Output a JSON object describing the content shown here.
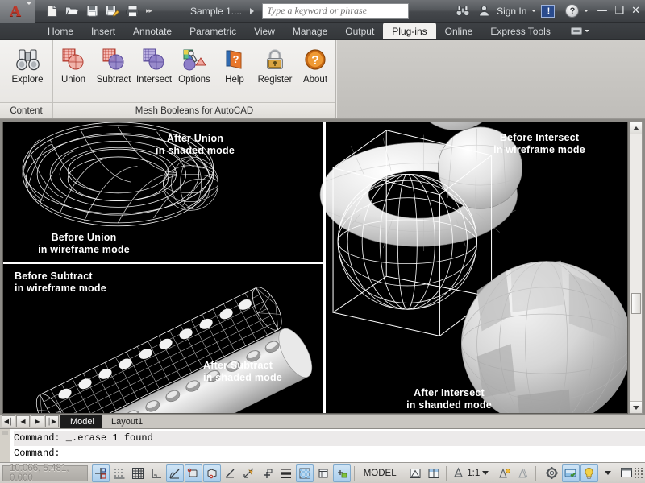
{
  "titlebar": {
    "app_logo": "autocad-a-logo",
    "quick_access": [
      {
        "name": "new-icon",
        "label": "New"
      },
      {
        "name": "open-icon",
        "label": "Open"
      },
      {
        "name": "save-icon",
        "label": "Save"
      },
      {
        "name": "save-as-icon",
        "label": "Save As"
      },
      {
        "name": "plot-icon",
        "label": "Plot"
      }
    ],
    "qat_more": "▸▸",
    "document_title": "Sample 1....",
    "search": {
      "placeholder": "Type a keyword or phrase",
      "value": ""
    },
    "search_icon": "binoculars-icon",
    "user_icon": "person-icon",
    "sign_in": "Sign In",
    "communication_center": "!",
    "help": "?",
    "window_controls": {
      "minimize": "—",
      "maximize": "❑",
      "close": "✕"
    }
  },
  "ribbon_tabs": {
    "items": [
      {
        "label": "Home",
        "active": false
      },
      {
        "label": "Insert",
        "active": false
      },
      {
        "label": "Annotate",
        "active": false
      },
      {
        "label": "Parametric",
        "active": false
      },
      {
        "label": "View",
        "active": false
      },
      {
        "label": "Manage",
        "active": false
      },
      {
        "label": "Output",
        "active": false
      },
      {
        "label": "Plug-ins",
        "active": true
      },
      {
        "label": "Online",
        "active": false
      },
      {
        "label": "Express Tools",
        "active": false
      }
    ]
  },
  "ribbon": {
    "panels": [
      {
        "label": "Content",
        "items": [
          {
            "label": "Explore",
            "icon": "binoculars-icon"
          }
        ]
      },
      {
        "label": "Mesh Booleans for AutoCAD",
        "items": [
          {
            "label": "Union",
            "icon": "boolean-union-icon"
          },
          {
            "label": "Subtract",
            "icon": "boolean-subtract-icon"
          },
          {
            "label": "Intersect",
            "icon": "boolean-intersect-icon"
          },
          {
            "label": "Options",
            "icon": "options-tools-icon"
          },
          {
            "label": "Help",
            "icon": "help-book-icon"
          },
          {
            "label": "Register",
            "icon": "padlock-icon"
          },
          {
            "label": "About",
            "icon": "about-question-icon"
          }
        ]
      }
    ]
  },
  "drawing": {
    "background_color": "#000000",
    "annotations": [
      {
        "name": "before-union-label",
        "line1": "Before Union",
        "line2": "in wireframe mode"
      },
      {
        "name": "after-union-label",
        "line1": "After Union",
        "line2": "in shaded mode"
      },
      {
        "name": "before-subtract-label",
        "line1": "Before Subtract",
        "line2": "in wireframe mode"
      },
      {
        "name": "after-subtract-label",
        "line1": "After Subtract",
        "line2": "in shaded mode"
      },
      {
        "name": "before-intersect-label",
        "line1": "Before Intersect",
        "line2": "in wireframe mode"
      },
      {
        "name": "after-intersect-label",
        "line1": "After Intersect",
        "line2": "in shanded mode"
      }
    ]
  },
  "layout_bar": {
    "nav": [
      "◀│",
      "◀",
      "▶",
      "│▶"
    ],
    "tabs": [
      {
        "label": "Model",
        "active": true
      },
      {
        "label": "Layout1",
        "active": false
      }
    ]
  },
  "command_line": {
    "lines": [
      "Command: _.erase 1 found",
      "Command:"
    ]
  },
  "status_bar": {
    "coordinates": "10.066, 5.481, 0.000",
    "toggles": [
      {
        "name": "snap-mode-toggle",
        "icon": "snap-icon",
        "on": true
      },
      {
        "name": "grid-display-toggle",
        "icon": "grid-dots-icon",
        "on": false
      },
      {
        "name": "grid-mode-toggle",
        "icon": "grid-icon",
        "on": false
      },
      {
        "name": "ortho-mode-toggle",
        "icon": "ortho-icon",
        "on": false
      },
      {
        "name": "polar-tracking-toggle",
        "icon": "polar-icon",
        "on": true
      },
      {
        "name": "object-snap-toggle",
        "icon": "osnap-icon",
        "on": true
      },
      {
        "name": "3d-object-snap-toggle",
        "icon": "osnap3d-icon",
        "on": true
      },
      {
        "name": "object-snap-tracking-toggle",
        "icon": "otrack-icon",
        "on": false
      },
      {
        "name": "dynamic-ucs-toggle",
        "icon": "dynamic-ucs-icon",
        "on": false
      },
      {
        "name": "dynamic-input-toggle",
        "icon": "dyn-input-icon",
        "on": false
      },
      {
        "name": "lineweight-toggle",
        "icon": "lineweight-icon",
        "on": true
      },
      {
        "name": "transparency-toggle",
        "icon": "transparency-icon",
        "on": false
      },
      {
        "name": "quick-properties-toggle",
        "icon": "quick-props-icon",
        "on": true
      }
    ],
    "model_label": "MODEL",
    "viewport_buttons": [
      {
        "name": "viewport-scale-button",
        "icon": "viewport-icon"
      },
      {
        "name": "viewport-config-button",
        "icon": "viewport-split-icon"
      }
    ],
    "annotation_scale": "1:1",
    "annotation_buttons": [
      {
        "name": "annotation-visibility-button",
        "icon": "annotation-visibility-icon"
      },
      {
        "name": "auto-scale-button",
        "icon": "auto-scale-icon"
      }
    ],
    "right_tools": [
      {
        "name": "workspace-switching-button",
        "icon": "gear-icon"
      },
      {
        "name": "toolbar-lock-button",
        "icon": "lock-toolbars-icon"
      },
      {
        "name": "hardware-acceleration-button",
        "icon": "lightbulb-icon"
      },
      {
        "name": "clean-screen-button",
        "icon": "clean-screen-icon"
      }
    ]
  }
}
